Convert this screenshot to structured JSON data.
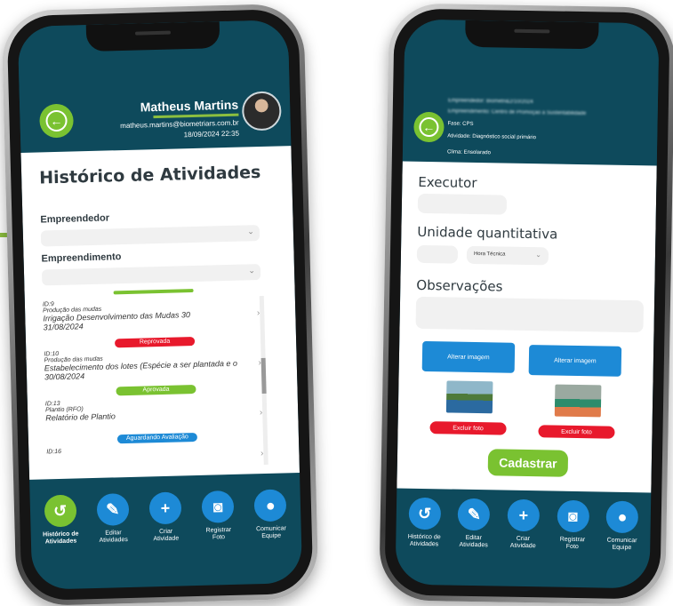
{
  "left": {
    "user": {
      "name": "Matheus Martins",
      "email": "matheus.martins@biometriars.com.br",
      "datetime": "18/09/2024 22:35"
    },
    "title": "Histórico de Atividades",
    "filters": {
      "empreendedor_label": "Empreendedor",
      "empreendimento_label": "Empreendimento"
    },
    "activities": [
      {
        "id": "ID:9",
        "phase": "Produção das mudas",
        "desc": "Irrigação Desenvolvimento das Mudas 30",
        "date": "31/08/2024",
        "status": "Reprovada",
        "status_color": "#e8192c"
      },
      {
        "id": "ID:10",
        "phase": "Produção das mudas",
        "desc": "Estabelecimento dos lotes (Espécie a ser plantada e o",
        "date": "30/08/2024",
        "status": "Aprovada",
        "status_color": "#7ac231"
      },
      {
        "id": "ID:13",
        "phase": "Plantio (RFO)",
        "desc": "Relatório de Plantio",
        "date": "",
        "status": "Aguardando Avaliação",
        "status_color": "#1d8ad6"
      },
      {
        "id": "ID:16",
        "phase": "",
        "desc": "",
        "date": "",
        "status": "",
        "status_color": ""
      }
    ]
  },
  "nav": [
    {
      "label": "Histórico de\nAtividades",
      "icon": "history-icon"
    },
    {
      "label": "Editar\nAtividades",
      "icon": "pencil-icon"
    },
    {
      "label": "Criar\nAtividade",
      "icon": "plus-icon"
    },
    {
      "label": "Registrar\nFoto",
      "icon": "camera-icon"
    },
    {
      "label": "Comunicar\nEquipe",
      "icon": "chat-icon"
    }
  ],
  "right": {
    "meta": {
      "empreendedor": "Empreendedor: Biometri&2/10/2024",
      "empreendimento": "Empreendimento: Centro de Promoção a Sustentabilidade",
      "fase": "Fase: CPS",
      "atividade": "Atividade: Diagnóstico social primário",
      "clima": "Clima: Ensolarado"
    },
    "executor_label": "Executor",
    "unidade_label": "Unidade quantitativa",
    "unidade_option": "Hora Técnica",
    "observacoes_label": "Observações",
    "alterar_label": "Alterar imagem",
    "excluir_label": "Excluir foto",
    "cadastrar_label": "Cadastrar"
  },
  "colors": {
    "header": "#0e4a5c",
    "accent_green": "#7ac231",
    "accent_blue": "#1d8ad6",
    "danger": "#e8192c"
  }
}
